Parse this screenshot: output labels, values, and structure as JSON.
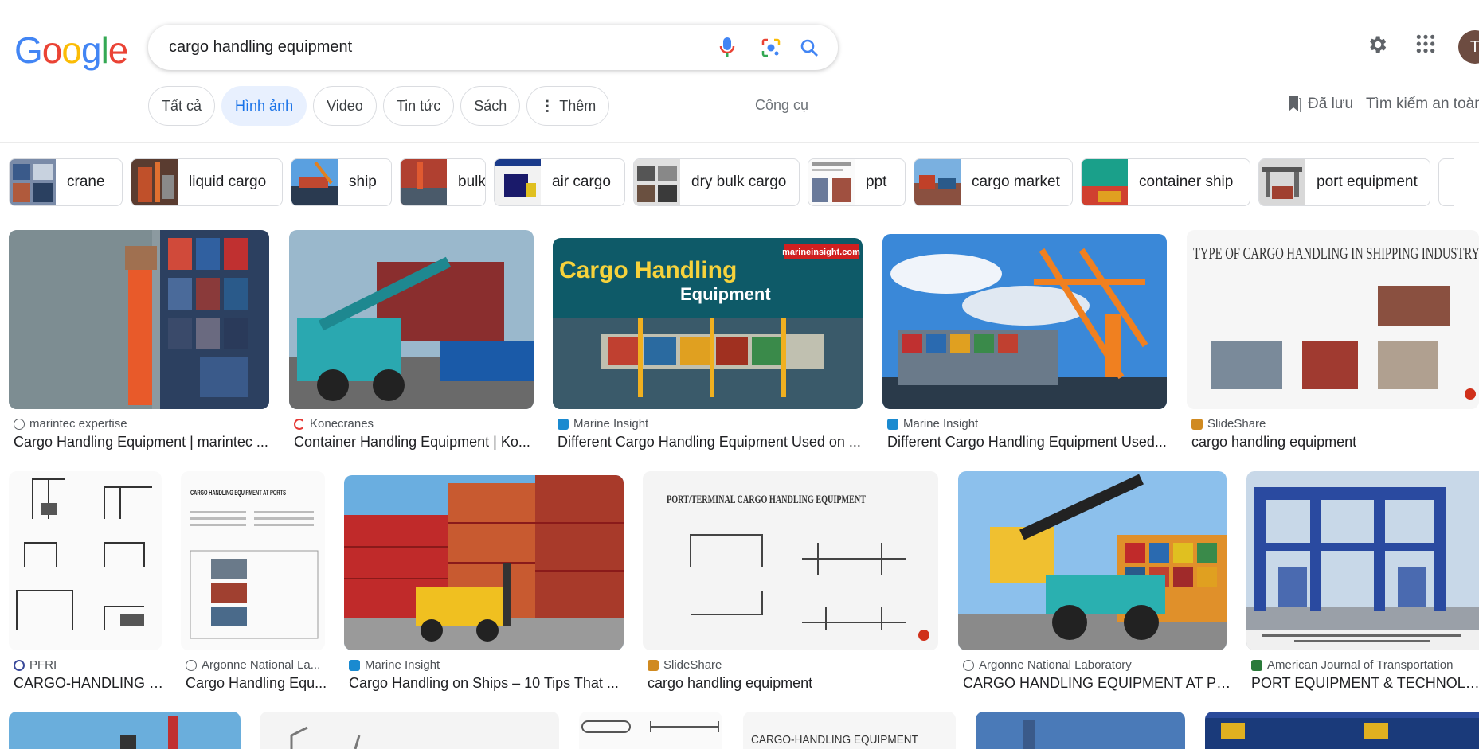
{
  "logo": {
    "text": "Google"
  },
  "search": {
    "query": "cargo handling equipment"
  },
  "nav": {
    "tabs": [
      {
        "label": "Tất cả"
      },
      {
        "label": "Hình ảnh"
      },
      {
        "label": "Video"
      },
      {
        "label": "Tin tức"
      },
      {
        "label": "Sách"
      },
      {
        "label": "Thêm"
      }
    ],
    "tools": "Công cụ",
    "saved": "Đã lưu",
    "safe_search": "Tìm kiếm an toàn"
  },
  "account": {
    "initial": "T"
  },
  "related": [
    {
      "label": "crane"
    },
    {
      "label": "liquid cargo"
    },
    {
      "label": "ship"
    },
    {
      "label": "bulk"
    },
    {
      "label": "air cargo"
    },
    {
      "label": "dry bulk cargo"
    },
    {
      "label": "ppt"
    },
    {
      "label": "cargo market"
    },
    {
      "label": "container ship"
    },
    {
      "label": "port equipment"
    }
  ],
  "results": [
    {
      "source": "marintec expertise",
      "title": "Cargo Handling Equipment | marintec ..."
    },
    {
      "source": "Konecranes",
      "title": "Container Handling Equipment | Ko..."
    },
    {
      "source": "Marine Insight",
      "title": "Different Cargo Handling Equipment Used on ...",
      "overlay_title": "Cargo Handling",
      "overlay_sub": "Equipment",
      "overlay_site": "marineinsight.com"
    },
    {
      "source": "Marine Insight",
      "title": "Different Cargo Handling Equipment Used..."
    },
    {
      "source": "SlideShare",
      "title": "cargo handling equipment",
      "overlay_title": "TYPE OF CARGO HANDLING IN SHIPPING INDUSTRY"
    },
    {
      "source": "PFRI",
      "title": "CARGO-HANDLING E..."
    },
    {
      "source": "Argonne National La...",
      "title": "Cargo Handling Equ...",
      "overlay_title": "CARGO HANDLING EQUIPMENT AT PORTS"
    },
    {
      "source": "Marine Insight",
      "title": "Cargo Handling on Ships – 10 Tips That ..."
    },
    {
      "source": "SlideShare",
      "title": "cargo handling equipment",
      "overlay_title": "PORT/TERMINAL CARGO HANDLING EQUIPMENT"
    },
    {
      "source": "Argonne National Laboratory",
      "title": "CARGO HANDLING EQUIPMENT AT PO..."
    },
    {
      "source": "American Journal of Transportation",
      "title": "PORT EQUIPMENT & TECHNOLOG..."
    }
  ],
  "partial": {
    "overlay_title": "CARGO-HANDLING EQUIPMENT"
  },
  "colors": {
    "accent": "#1a73e8",
    "chip_active_bg": "#e8f0fe"
  }
}
